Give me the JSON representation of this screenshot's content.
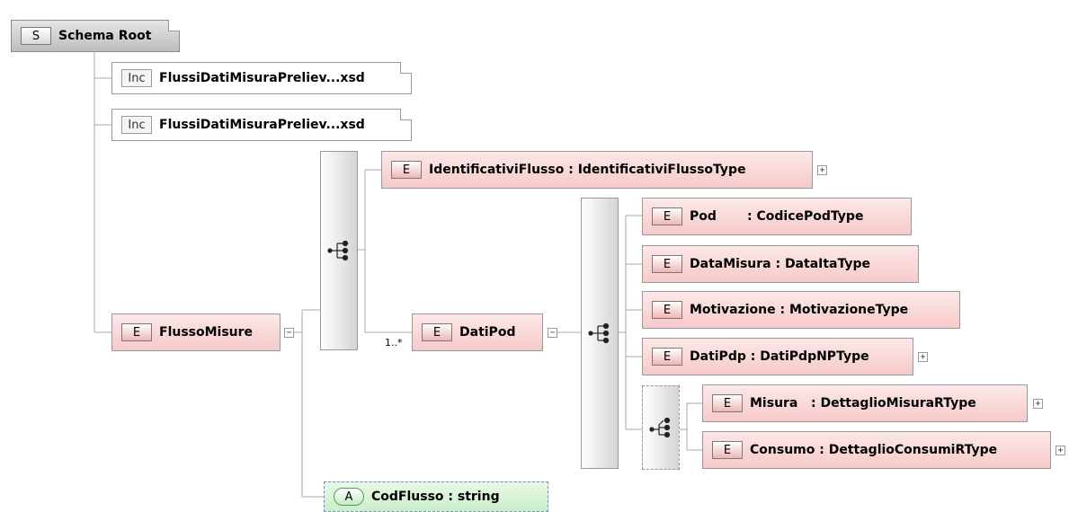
{
  "root": {
    "badge": "S",
    "name": "Schema Root"
  },
  "includes": [
    {
      "badge": "Inc",
      "name": "FlussiDatiMisuraPreliev...xsd"
    },
    {
      "badge": "Inc",
      "name": "FlussiDatiMisuraPreliev...xsd"
    }
  ],
  "elements": {
    "identificativi": {
      "badge": "E",
      "name": "IdentificativiFlusso",
      "type": " : IdentificativiFlussoType"
    },
    "flussoMisure": {
      "badge": "E",
      "name": "FlussoMisure",
      "type": ""
    },
    "datiPod": {
      "badge": "E",
      "name": "DatiPod",
      "type": ""
    },
    "pod": {
      "badge": "E",
      "name": "Pod",
      "type": "       : CodicePodType"
    },
    "dataMisura": {
      "badge": "E",
      "name": "DataMisura",
      "type": " : DataItaType"
    },
    "motivazione": {
      "badge": "E",
      "name": "Motivazione",
      "type": " : MotivazioneType"
    },
    "datiPdp": {
      "badge": "E",
      "name": "DatiPdp",
      "type": " : DatiPdpNPType"
    },
    "misura": {
      "badge": "E",
      "name": "Misura",
      "type": "   : DettaglioMisuraRType"
    },
    "consumo": {
      "badge": "E",
      "name": "Consumo",
      "type": " : DettaglioConsumiRType"
    }
  },
  "attribute": {
    "badge": "A",
    "name": "CodFlusso",
    "type": " : string"
  },
  "cardinality": {
    "datiPod": "1..*"
  },
  "expanders": {
    "plus": "+",
    "minus": "−"
  },
  "icons": {
    "sequence": "sequence-icon",
    "choice": "choice-icon"
  }
}
